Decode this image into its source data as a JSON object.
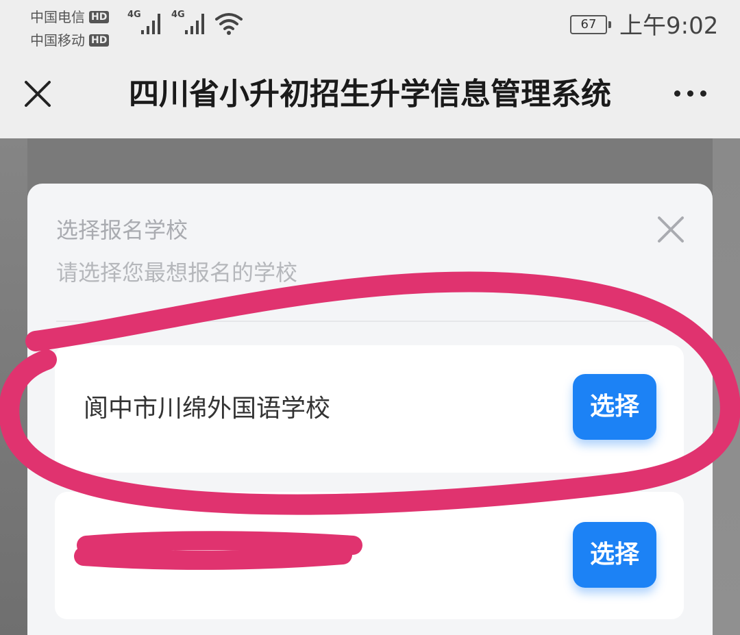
{
  "status_bar": {
    "carrier_1": "中国电信",
    "carrier_2": "中国移动",
    "hd_badge": "HD",
    "network_1": "4G",
    "network_2": "4G",
    "battery": "67",
    "time": "上午9:02"
  },
  "title_bar": {
    "title": "四川省小升初招生升学信息管理系统",
    "close_icon": "close-icon",
    "more_icon": "more-icon"
  },
  "modal": {
    "title": "选择报名学校",
    "subtitle": "请选择您最想报名的学校",
    "close_icon": "close-icon"
  },
  "schools": [
    {
      "name": "阆中市川绵外国语学校",
      "button_label": "选择"
    },
    {
      "name": "",
      "button_label": "选择"
    }
  ],
  "colors": {
    "accent": "#1c82f5",
    "annotation": "#e0336f"
  }
}
